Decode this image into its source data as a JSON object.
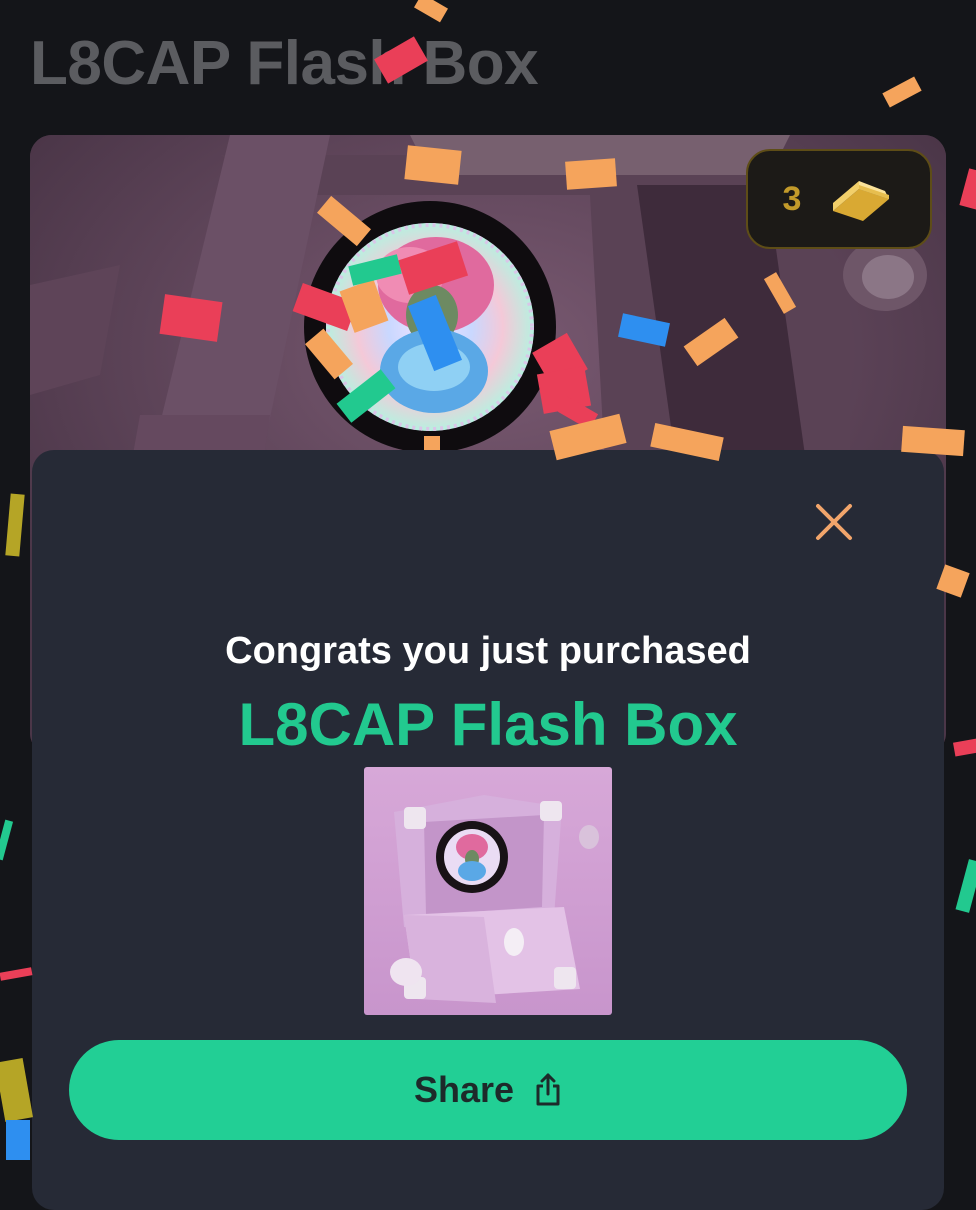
{
  "page": {
    "title": "L8CAP Flash Box"
  },
  "balance": {
    "count": "3",
    "icon": "gold-bar-icon"
  },
  "modal": {
    "congrats_text": "Congrats you just purchased",
    "product_name": "L8CAP Flash Box",
    "close_icon": "close-icon",
    "share_label": "Share",
    "share_icon": "share-icon"
  },
  "colors": {
    "background": "#141519",
    "modal": "#262a36",
    "accent": "#22cf95",
    "close": "#f2a56b",
    "gold": "#c29a2a"
  }
}
